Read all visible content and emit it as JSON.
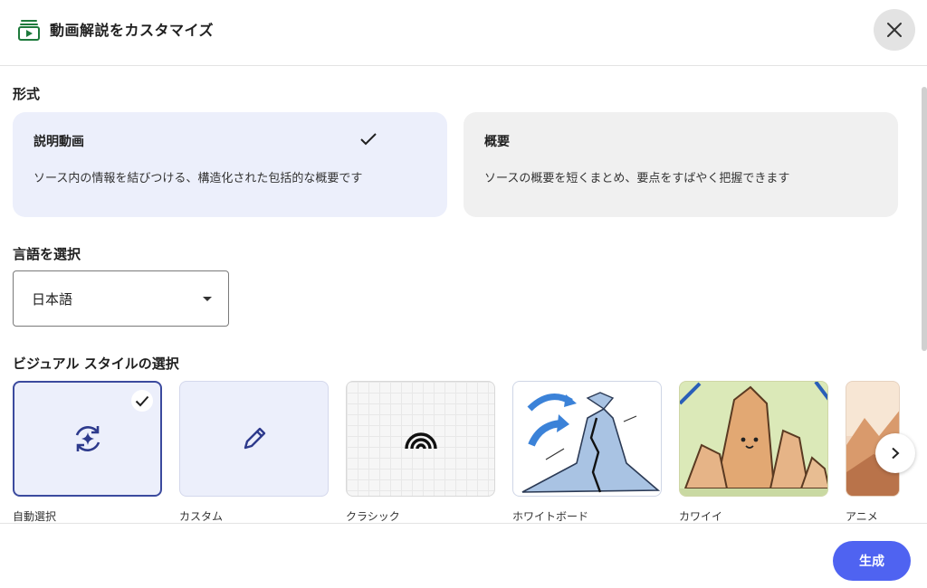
{
  "dialog": {
    "title": "動画解説をカスタマイズ",
    "icon": "video-overview-icon",
    "close_icon": "close-icon"
  },
  "format": {
    "label": "形式",
    "options": [
      {
        "title": "説明動画",
        "description": "ソース内の情報を結びつける、構造化された包括的な概要です",
        "selected": true
      },
      {
        "title": "概要",
        "description": "ソースの概要を短くまとめ、要点をすばやく把握できます",
        "selected": false
      }
    ]
  },
  "language": {
    "label": "言語を選択",
    "selected": "日本語"
  },
  "visual_style": {
    "label": "ビジュアル スタイルの選択",
    "options": [
      {
        "label": "自動選択",
        "icon": "auto-refresh-sparkle-icon",
        "selected": true
      },
      {
        "label": "カスタム",
        "icon": "pencil-icon",
        "selected": false
      },
      {
        "label": "クラシック",
        "icon": "rainbow-arcs-icon",
        "selected": false
      },
      {
        "label": "ホワイトボード",
        "icon": "volcano-sketch-thumbnail",
        "selected": false
      },
      {
        "label": "カワイイ",
        "icon": "cute-mountains-thumbnail",
        "selected": false
      },
      {
        "label": "アニメ",
        "icon": "anime-landscape-thumbnail",
        "selected": false
      }
    ],
    "next_icon": "chevron-right-icon"
  },
  "footer": {
    "generate_label": "生成"
  },
  "colors": {
    "accent": "#4f63f1",
    "selected_card": "#eceffb",
    "selected_border": "#3b4a9e"
  }
}
